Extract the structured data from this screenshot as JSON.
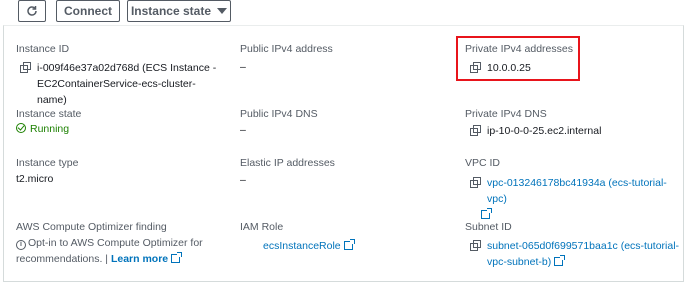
{
  "toolbar": {
    "refresh_icon": "refresh-icon",
    "connect_label": "Connect",
    "instance_state_label": "Instance state"
  },
  "fields": {
    "instance_id": {
      "label": "Instance ID",
      "value": "i-009f46e37a02d768d (ECS Instance - EC2ContainerService-ecs-cluster-name)"
    },
    "public_ipv4": {
      "label": "Public IPv4 address",
      "value": "–"
    },
    "private_ipv4": {
      "label": "Private IPv4 addresses",
      "value": "10.0.0.25"
    },
    "instance_state": {
      "label": "Instance state",
      "value": "Running"
    },
    "public_dns": {
      "label": "Public IPv4 DNS",
      "value": "–"
    },
    "private_dns": {
      "label": "Private IPv4 DNS",
      "value": "ip-10-0-0-25.ec2.internal"
    },
    "instance_type": {
      "label": "Instance type",
      "value": "t2.micro"
    },
    "elastic_ip": {
      "label": "Elastic IP addresses",
      "value": "–"
    },
    "vpc_id": {
      "label": "VPC ID",
      "value": "vpc-013246178bc41934a (ecs-tutorial-vpc)"
    },
    "optimizer": {
      "label": "AWS Compute Optimizer finding",
      "text": "Opt-in to AWS Compute Optimizer for recommendations. |",
      "link": "Learn more"
    },
    "iam_role": {
      "label": "IAM Role",
      "value": "ecsInstanceRole"
    },
    "subnet_id": {
      "label": "Subnet ID",
      "value": "subnet-065d0f699571baa1c (ecs-tutorial-vpc-subnet-b)"
    }
  },
  "colors": {
    "link": "#0073bb",
    "success": "#1d8102",
    "highlight": "#e8141b",
    "label": "#545b64"
  }
}
